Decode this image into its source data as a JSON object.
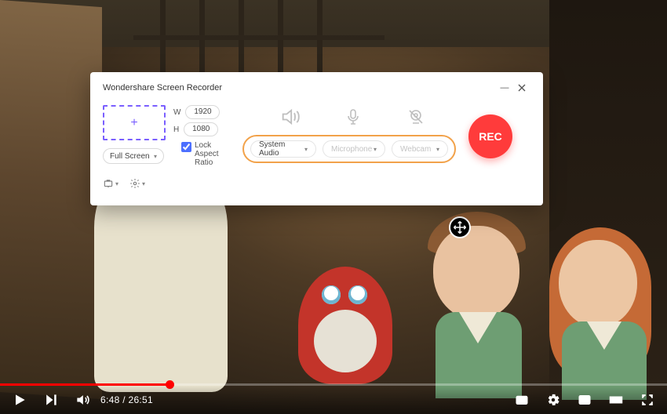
{
  "recorder": {
    "title": "Wondershare Screen Recorder",
    "width_label": "W",
    "height_label": "H",
    "width_value": "1920",
    "height_value": "1080",
    "fullscreen_label": "Full Screen",
    "lock_label": "Lock Aspect Ratio",
    "lock_checked": true,
    "source_sysaudio": "System Audio",
    "source_microphone": "Microphone",
    "source_webcam": "Webcam",
    "rec_label": "REC"
  },
  "player": {
    "current_time": "6:48",
    "duration": "26:51",
    "progress_pct": 25.4
  }
}
